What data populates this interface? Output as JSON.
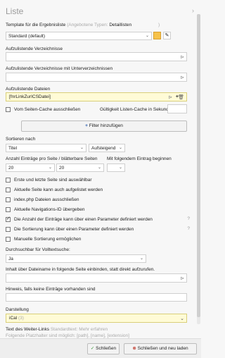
{
  "title": "Liste",
  "template": {
    "label": "Template für die Ergebnisliste",
    "hint": "(Angebotene Typen:",
    "type": "Detaillisten",
    "hint_end": ")",
    "value": "Standard (default)"
  },
  "dirs_label": "Aufzulistende Verzeichnisse",
  "dirs_sub_label": "Aufzulistende Verzeichnisse mit Unterverzeichnissen",
  "files_label": "Aufzulistende Dateien",
  "files_value": "[fnrLinkZurICSDatei]",
  "page_cache_label": "Vom Seiten-Cache ausschließen",
  "cache_validity_label": "Gültigkeit Listen-Cache in Sekunden",
  "add_filter_label": "Filter hinzufügen",
  "sort_label": "Sortieren nach",
  "sort_by": "Titel",
  "sort_dir": "Aufsteigend",
  "per_page_label": "Anzahl Einträge pro Seite / blätterbare Seiten",
  "start_label": "Mit folgendem Eintrag beginnen",
  "per_page_value": "20",
  "pages_value": "20",
  "start_value": "",
  "options": [
    {
      "label": "Erste und letzte Seite sind auswählbar",
      "checked": false,
      "help": false
    },
    {
      "label": "Aktuelle Seite kann auch aufgelistet werden",
      "checked": false,
      "help": false
    },
    {
      "label": "index.php Dateien ausschließen",
      "checked": false,
      "help": false
    },
    {
      "label": "Aktuelle Navigations-ID übergeben",
      "checked": false,
      "help": false
    },
    {
      "label": "Die Anzahl der Einträge kann über einen Parameter definiert werden",
      "checked": true,
      "help": true
    },
    {
      "label": "Die Sortierung kann über einen Parameter definiert werden",
      "checked": false,
      "help": true
    },
    {
      "label": "Manuelle Sortierung ermöglichen",
      "checked": false,
      "help": false
    }
  ],
  "fulltext_label": "Durchsuchbar für Volltextsuche:",
  "fulltext_value": "Ja",
  "embed_label": "Inhalt über Dateiname in folgende Seite einbinden, statt direkt aufzurufen.",
  "empty_hint_label": "Hinweis, falls keine Einträge vorhanden sind",
  "display_label": "Darstellung",
  "display_value": "iCal",
  "display_hint": "(3)",
  "more_link_label": "Text des Weiter-Links",
  "more_link_placeholder": "Standardtext: Mehr erfahren",
  "placeholders_text": "Folgende Platzhalter sind möglich: [path], [name], [extension]",
  "buttons": {
    "close": "Schließen",
    "close_reload": "Schließen und neu laden"
  },
  "icons": {
    "folder": "folder-icon",
    "edit": "edit-icon",
    "plus": "plus-icon",
    "trash": "trash-icon",
    "check": "check-icon",
    "close": "close-icon"
  },
  "colors": {
    "yellow_field": "#fffbd6",
    "check_green": "#3c9a3c",
    "close_red": "#c0392b",
    "folder": "#e0a020"
  }
}
